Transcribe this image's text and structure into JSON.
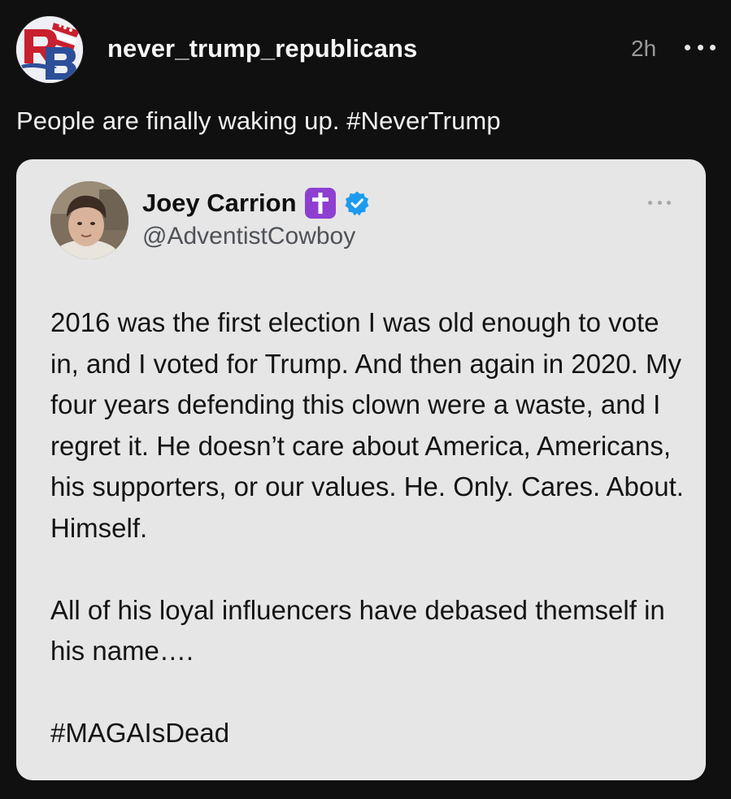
{
  "post": {
    "username": "never_trump_republicans",
    "time": "2h",
    "caption": "People are finally waking up. #NeverTrump",
    "avatar_icon": "rb-logo-icon",
    "more_icon": "more-horizontal-icon"
  },
  "quote": {
    "name": "Joey Carrion",
    "handle": "@AdventistCowboy",
    "badge_icon": "latin-cross-icon",
    "verified_icon": "verified-badge-icon",
    "body_paragraphs": [
      "2016 was the first election I was old enough to vote in, and I voted for Trump. And then again in 2020. My four years defending this clown were a waste, and I regret it. He doesn’t care about America, Americans, his supporters, or our values. He. Only. Cares. About. Himself.",
      "All of his loyal influencers have debased themself in his name….",
      "#MAGAIsDead"
    ]
  },
  "colors": {
    "background": "#101010",
    "card": "#e6e6e6",
    "verified": "#1d9bf0",
    "cross_badge": "#8e3fd0",
    "muted_text": "#9a9a9a"
  }
}
